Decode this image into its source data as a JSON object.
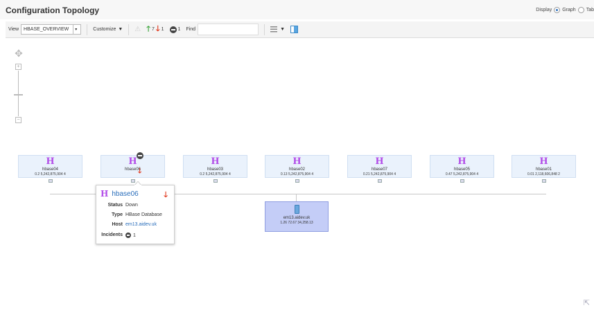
{
  "header": {
    "title": "Configuration Topology",
    "display_label": "Display",
    "options": [
      {
        "label": "Graph",
        "selected": true
      },
      {
        "label": "Tab",
        "selected": false
      }
    ]
  },
  "toolbar": {
    "view_label": "View",
    "view_value": "HBASE_OVERVIEW",
    "customize_label": "Customize",
    "up_count": "7",
    "down_count": "1",
    "incident_count": "1",
    "find_label": "Find",
    "find_value": ""
  },
  "nodes": [
    {
      "name": "hbase04",
      "metrics": "0.2  5,242,875,904  4",
      "status": "up"
    },
    {
      "name": "hbase06",
      "metrics": "",
      "status": "down"
    },
    {
      "name": "hbase03",
      "metrics": "0.2  5,242,875,904  4",
      "status": "up"
    },
    {
      "name": "hbase02",
      "metrics": "0.13  5,242,875,904  4",
      "status": "up"
    },
    {
      "name": "hbase07",
      "metrics": "0.21  5,242,875,904  4",
      "status": "up"
    },
    {
      "name": "hbase05",
      "metrics": "0.47  5,242,875,904  4",
      "status": "up"
    },
    {
      "name": "hbase01",
      "metrics": "0.01  2,118,606,848  2",
      "status": "up"
    }
  ],
  "host": {
    "name": "em13.aidev.uk",
    "metrics": "1.26  72.67  34,258.13"
  },
  "popup": {
    "title": "hbase06",
    "status_label": "Status",
    "status_value": "Down",
    "type_label": "Type",
    "type_value": "HBase Database",
    "host_label": "Host",
    "host_value": "em13.aidev.uk",
    "incidents_label": "Incidents",
    "incidents_value": "1"
  },
  "colors": {
    "hbase_icon": "#b24ce8",
    "node_bg": "#eaf2fc",
    "host_bg": "#c4cdf7",
    "up": "#39a339",
    "down": "#e0361b",
    "link": "#2a6ebb"
  }
}
